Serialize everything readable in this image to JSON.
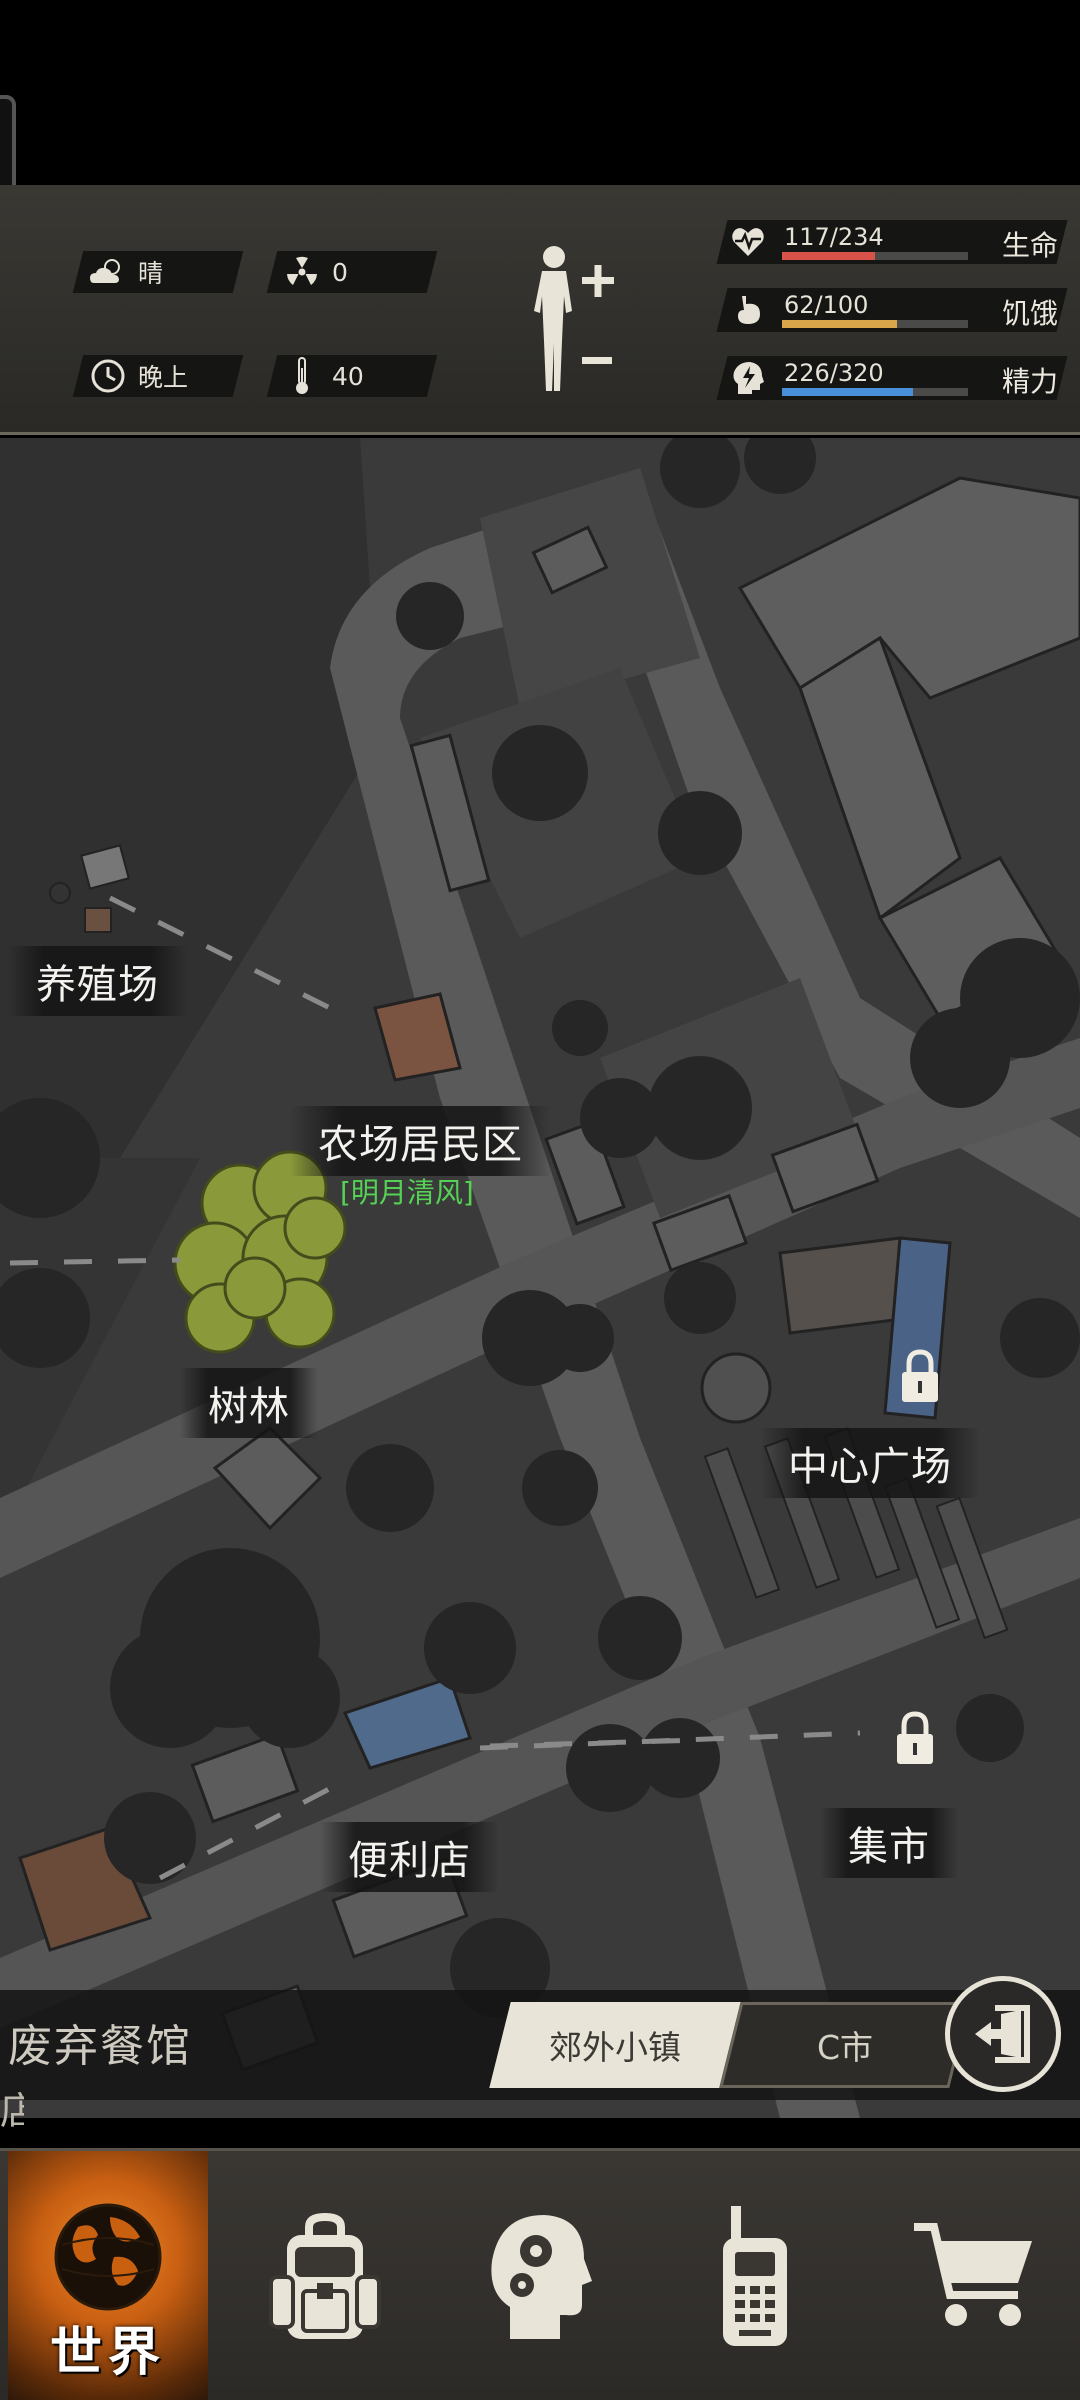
{
  "hud": {
    "weather": "晴",
    "radiation": "0",
    "time_of_day": "晚上",
    "temperature": "40",
    "bars": {
      "life": {
        "value": "117/234",
        "label": "生命",
        "fraction": 0.5,
        "color": "#d9534a"
      },
      "hunger": {
        "value": "62/100",
        "label": "饥饿",
        "fraction": 0.62,
        "color": "#d9a64a"
      },
      "energy": {
        "value": "226/320",
        "label": "精力",
        "fraction": 0.706,
        "color": "#4a8fd9"
      }
    }
  },
  "map": {
    "locations": {
      "farm": "养殖场",
      "residential": "农场居民区",
      "residential_sub": "[明月清风]",
      "forest": "树林",
      "plaza": "中心广场",
      "market": "集市",
      "store": "便利店"
    }
  },
  "regions": {
    "partial_left": "废弃餐馆",
    "partial_left2": "店",
    "suburb": "郊外小镇",
    "city": "C市"
  },
  "nav": {
    "world": "世界"
  },
  "icons": {
    "weather": "cloud-sun-icon",
    "radiation": "radiation-icon",
    "time": "clock-icon",
    "temperature": "thermometer-icon",
    "life": "heart-pulse-icon",
    "hunger": "stomach-icon",
    "energy": "head-bolt-icon",
    "exit": "exit-door-icon",
    "bag": "backpack-icon",
    "skills": "head-gears-icon",
    "radio": "walkie-talkie-icon",
    "shop": "shopping-cart-icon",
    "world": "globe-icon",
    "lock": "lock-icon"
  }
}
